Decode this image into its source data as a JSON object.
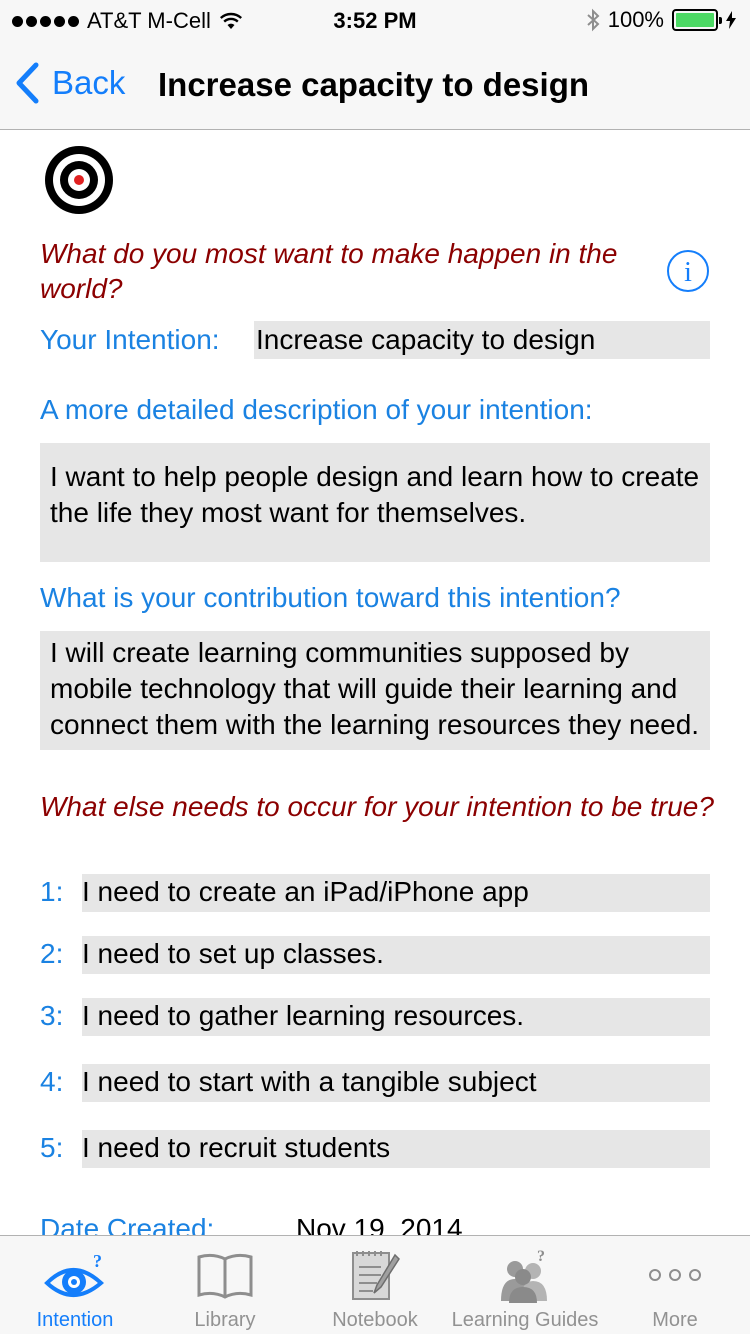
{
  "status_bar": {
    "carrier": "AT&T M-Cell",
    "time": "3:52 PM",
    "battery": "100%",
    "battery_level": 1.0
  },
  "nav": {
    "back_label": "Back",
    "title": "Increase capacity to design"
  },
  "content": {
    "question_main": "What do you most want to make happen in the world?",
    "intention_label": "Your Intention:",
    "intention_value": "Increase capacity to design",
    "detailed_label": "A more detailed description of your intention:",
    "detailed_value": "I want to help people design and learn how to create the life they most want for themselves.",
    "contribution_label": "What is your contribution toward this intention?",
    "contribution_value": "I will create learning communities supposed by mobile technology that will guide their learning and connect them with the learning resources they need.",
    "question_else": "What else needs to occur for your intention to be true?",
    "needs": [
      {
        "num": "1:",
        "text": "I need to create an iPad/iPhone app"
      },
      {
        "num": "2:",
        "text": "I need to set up classes."
      },
      {
        "num": "3:",
        "text": "I need to gather learning resources."
      },
      {
        "num": "4:",
        "text": "I need to start with a tangible subject"
      },
      {
        "num": "5:",
        "text": "I need to recruit students"
      }
    ],
    "date_label": "Date Created:",
    "date_value": "Nov 19, 2014"
  },
  "tabbar": {
    "tabs": [
      {
        "label": "Intention",
        "icon": "eye-question-icon",
        "active": true
      },
      {
        "label": "Library",
        "icon": "book-icon",
        "active": false
      },
      {
        "label": "Notebook",
        "icon": "notebook-pencil-icon",
        "active": false
      },
      {
        "label": "Learning Guides",
        "icon": "people-question-icon",
        "active": false
      },
      {
        "label": "More",
        "icon": "more-dots-icon",
        "active": false
      }
    ]
  },
  "colors": {
    "accent": "#147efb",
    "question": "#8b0000",
    "label_blue": "#1a82e2",
    "field_bg": "#e6e6e6"
  }
}
